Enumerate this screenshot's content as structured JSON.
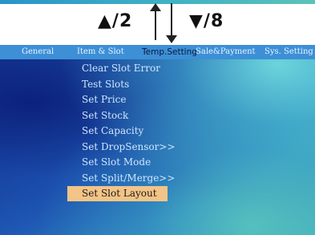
{
  "hints": {
    "up_text": "▲/2",
    "down_text": "▼/8"
  },
  "tabs": [
    {
      "label": "General"
    },
    {
      "label": "Item & Slot"
    },
    {
      "label": "Temp.Setting"
    },
    {
      "label": "Sale&Payment"
    },
    {
      "label": "Sys. Setting"
    }
  ],
  "menu": {
    "items": [
      {
        "label": "Clear Slot Error"
      },
      {
        "label": "Test Slots"
      },
      {
        "label": "Set Price"
      },
      {
        "label": "Set Stock"
      },
      {
        "label": "Set Capacity"
      },
      {
        "label": "Set DropSensor>>"
      },
      {
        "label": "Set Slot Mode"
      },
      {
        "label": "Set Split/Merge>>"
      },
      {
        "label": "Set Slot Layout"
      }
    ],
    "selected": "Set Slot Layout"
  },
  "colors": {
    "tabbar": "#3d8fd6",
    "selection": "#f3c487"
  }
}
